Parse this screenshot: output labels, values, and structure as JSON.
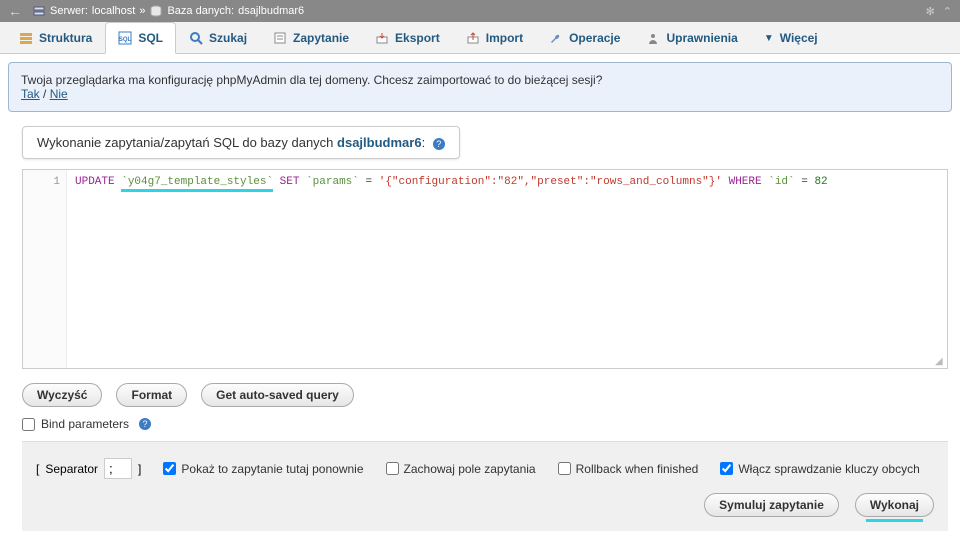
{
  "topbar": {
    "server_label": "Serwer:",
    "server_name": "localhost",
    "separator": "»",
    "db_label": "Baza danych:",
    "db_name": "dsajlbudmar6"
  },
  "tabs": [
    {
      "label": "Struktura"
    },
    {
      "label": "SQL"
    },
    {
      "label": "Szukaj"
    },
    {
      "label": "Zapytanie"
    },
    {
      "label": "Eksport"
    },
    {
      "label": "Import"
    },
    {
      "label": "Operacje"
    },
    {
      "label": "Uprawnienia"
    },
    {
      "label": "Więcej"
    }
  ],
  "notice": {
    "text": "Twoja przeglądarka ma konfigurację phpMyAdmin dla tej domeny. Chcesz zaimportować to do bieżącej sesji?",
    "yes": "Tak",
    "no": "Nie",
    "sep": " / "
  },
  "sql_title": {
    "prefix": "Wykonanie zapytania/zapytań SQL do bazy danych ",
    "db": "dsajlbudmar6",
    "colon": ":"
  },
  "editor": {
    "line_no": "1",
    "kw_update": "UPDATE",
    "tbl": "`y04g7_template_styles`",
    "kw_set": "SET",
    "col": "`params`",
    "eq": "=",
    "val": "'{\"configuration\":\"82\",\"preset\":\"rows_and_columns\"}'",
    "kw_where": "WHERE",
    "col2": "`id`",
    "num": "82"
  },
  "buttons": {
    "clear": "Wyczyść",
    "format": "Format",
    "auto_saved": "Get auto-saved query"
  },
  "bind_parameters": "Bind parameters",
  "footer": {
    "separator_label": "Separator",
    "separator_value": ";",
    "show_again": "Pokaż to zapytanie tutaj ponownie",
    "retain": "Zachowaj pole zapytania",
    "rollback": "Rollback when finished",
    "fk": "Włącz sprawdzanie kluczy obcych",
    "simulate": "Symuluj zapytanie",
    "execute": "Wykonaj"
  }
}
